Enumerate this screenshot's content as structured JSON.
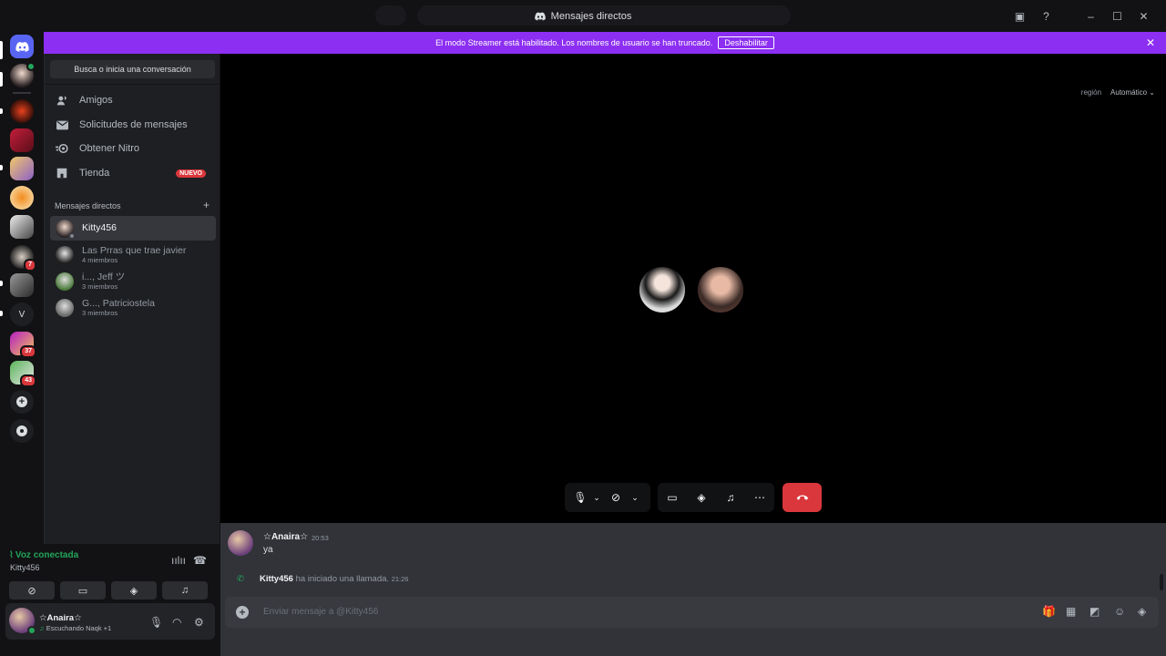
{
  "window": {
    "title": "Mensajes directos"
  },
  "banner": {
    "text": "El modo Streamer está habilitado. Los nombres de usuario se han truncado.",
    "button": "Deshabilitar"
  },
  "guilds": {
    "badges": [
      "7",
      "37",
      "43"
    ],
    "letter": "V"
  },
  "sidebar": {
    "search": "Busca o inicia una conversación",
    "nav": [
      {
        "label": "Amigos",
        "icon": "friends-icon"
      },
      {
        "label": "Solicitudes de mensajes",
        "icon": "mail-icon"
      },
      {
        "label": "Obtener Nitro",
        "icon": "nitro-icon"
      },
      {
        "label": "Tienda",
        "icon": "shop-icon",
        "badge": "NUEVO"
      }
    ],
    "dm_header": "Mensajes directos",
    "dms": [
      {
        "name": "Kitty456",
        "sub": ""
      },
      {
        "name": "Las Prras que trae javier",
        "sub": "4 miembros"
      },
      {
        "name": "i..., Jeff ツ",
        "sub": "3 miembros"
      },
      {
        "name": "G..., Patriciostela",
        "sub": "3 miembros"
      }
    ]
  },
  "voice": {
    "status": "Voz conectada",
    "channel": "Kitty456"
  },
  "user": {
    "name": "☆Anaira☆",
    "status": "Escuchando Naqk +1"
  },
  "call": {
    "region_label": "región",
    "region_value": "Automático"
  },
  "chat": {
    "message_author": "☆Anaira☆",
    "message_time": "20:53",
    "message_text": "ya",
    "system_who": "Kitty456",
    "system_text": " ha iniciado una llamada. ",
    "system_time": "21:26",
    "placeholder": "Enviar mensaje a @Kitty456"
  },
  "colors": {
    "accent": "#8c2ff2",
    "danger": "#da373c",
    "online": "#23a55a",
    "blurple": "#5865f2"
  }
}
